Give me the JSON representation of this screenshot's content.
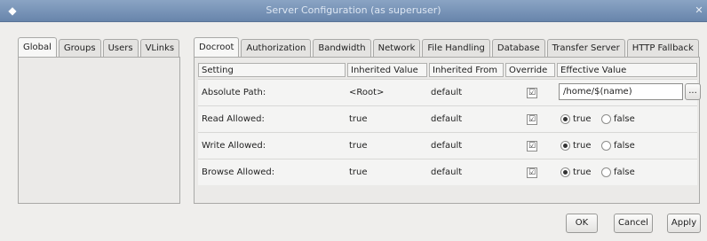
{
  "window": {
    "title": "Server Configuration (as superuser)",
    "icon": "app-icon",
    "close_icon": "close-icon"
  },
  "left_tabs": [
    "Global",
    "Groups",
    "Users",
    "VLinks"
  ],
  "right_tabs": [
    "Docroot",
    "Authorization",
    "Bandwidth",
    "Network",
    "File Handling",
    "Database",
    "Transfer Server",
    "HTTP Fallback"
  ],
  "table": {
    "headers": [
      "Setting",
      "Inherited Value",
      "Inherited From",
      "Override",
      "Effective Value"
    ],
    "rows": [
      {
        "setting": "Absolute Path:",
        "inherited_value": "<Root>",
        "inherited_from": "default",
        "override": true,
        "effective": "/home/$(name)"
      },
      {
        "setting": "Read Allowed:",
        "inherited_value": "true",
        "inherited_from": "default",
        "override": true,
        "effective": "true"
      },
      {
        "setting": "Write Allowed:",
        "inherited_value": "true",
        "inherited_from": "default",
        "override": true,
        "effective": "true"
      },
      {
        "setting": "Browse Allowed:",
        "inherited_value": "true",
        "inherited_from": "default",
        "override": true,
        "effective": "true"
      }
    ],
    "browse_label": "...",
    "radio_true": "true",
    "radio_false": "false",
    "check_mark": "☑"
  },
  "buttons": {
    "ok": "OK",
    "cancel": "Cancel",
    "apply": "Apply"
  }
}
